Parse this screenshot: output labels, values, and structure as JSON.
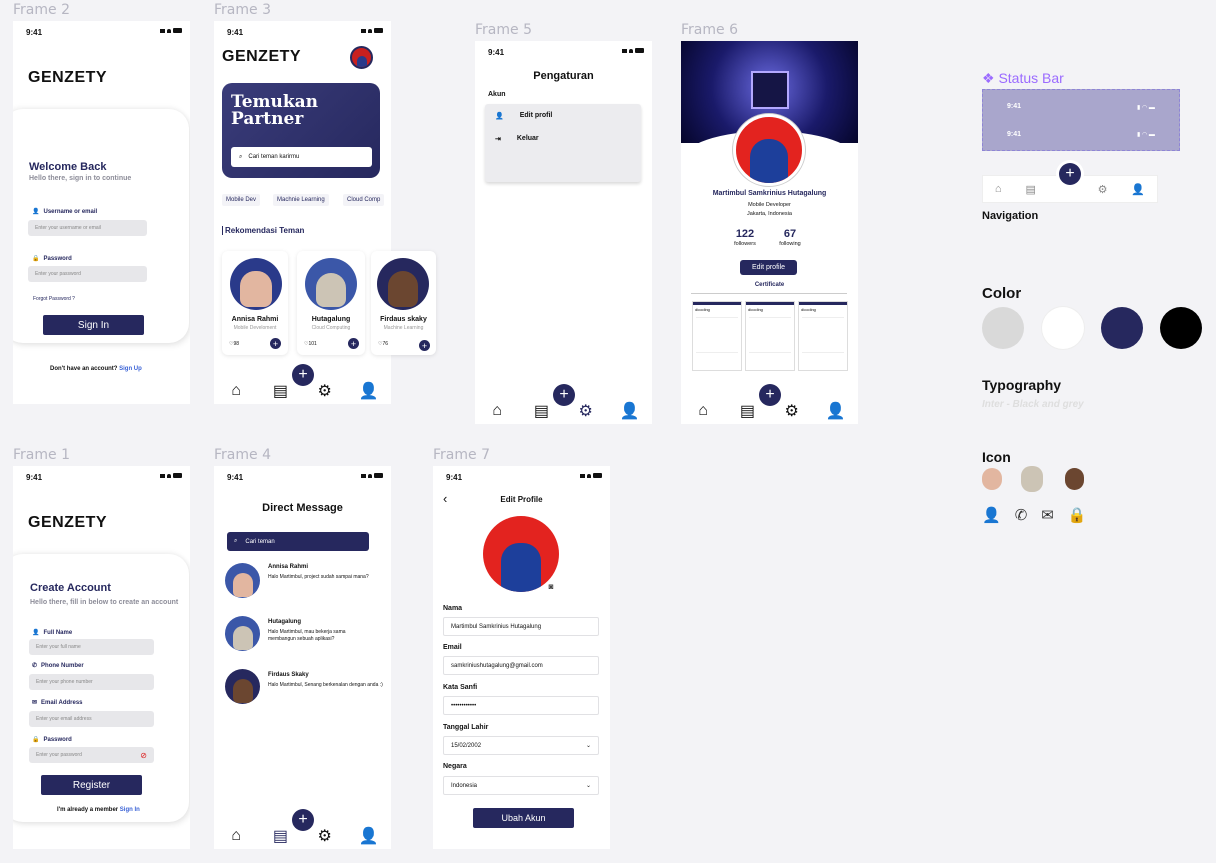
{
  "frames": {
    "f2": "Frame 2",
    "f3": "Frame 3",
    "f5": "Frame 5",
    "f6": "Frame 6",
    "f1": "Frame 1",
    "f4": "Frame 4",
    "f7": "Frame 7"
  },
  "time": "9:41",
  "brand": "GENZETY",
  "login": {
    "title": "Welcome Back",
    "subtitle": "Hello there, sign in to continue",
    "user_label": "Username or email",
    "user_ph": "Enter your username or email",
    "pass_label": "Password",
    "pass_ph": "Enter your password",
    "forgot": "Forgot Password ?",
    "btn": "Sign In",
    "footer": "Don't have an account?",
    "footer_link": "Sign Up"
  },
  "home": {
    "hero_line1": "Temukan",
    "hero_line2": "Partner",
    "search_ph": "Cari teman karirmu",
    "chips": [
      "Mobile Dev",
      "Machnie Learning",
      "Cloud Comp"
    ],
    "section": "Rekomendasi Teman",
    "people": [
      {
        "name": "Annisa Rahmi",
        "role": "Mobile Develoment",
        "likes": "98"
      },
      {
        "name": "Hutagalung",
        "role": "Cloud Computing",
        "likes": "101"
      },
      {
        "name": "Firdaus skaky",
        "role": "Machine Learning",
        "likes": "76"
      }
    ]
  },
  "settings": {
    "title": "Pengaturan",
    "section": "Akun",
    "items": [
      "Edit profil",
      "Keluar"
    ]
  },
  "profile": {
    "name": "Martimbul Samkrinius Hutagalung",
    "role": "Mobile Developer",
    "location": "Jakarta, Indonesia",
    "followers": "122",
    "followers_label": "followers",
    "following": "67",
    "following_label": "following",
    "btn": "Edit profile",
    "tab": "Certificate",
    "cert_brand": "dicoding"
  },
  "register": {
    "title": "Create Account",
    "subtitle": "Hello there, fill in below to create an account",
    "name_label": "Full Name",
    "name_ph": "Enter your full name",
    "phone_label": "Phone Number",
    "phone_ph": "Enter your phone number",
    "email_label": "Email Address",
    "email_ph": "Enter your email address",
    "pass_label": "Password",
    "pass_ph": "Enter your password",
    "btn": "Register",
    "footer": "I'm already a member",
    "footer_link": "Sign In"
  },
  "dm": {
    "title": "Direct Message",
    "search_ph": "Cari teman",
    "messages": [
      {
        "name": "Annisa Rahmi",
        "text": "Halo Martimbul, project sudah sampai mana?"
      },
      {
        "name": "Hutagalung",
        "text": "Halo Martimbul, mau bekerja sama membangun sebuah aplikasi?"
      },
      {
        "name": "Firdaus Skaky",
        "text": "Halo Martimbul, Senang berkenalan dengan anda :)"
      }
    ]
  },
  "edit": {
    "title": "Edit Profile",
    "nama_label": "Nama",
    "nama": "Martimbul Samkrinius Hutagalung",
    "email_label": "Email",
    "email": "samkriniushutagalung@gmail.com",
    "pass_label": "Kata Sanfi",
    "pass": "••••••••••••",
    "dob_label": "Tanggal Lahir",
    "dob": "15/02/2002",
    "country_label": "Negara",
    "country": "Indonesia",
    "btn": "Ubah Akun"
  },
  "guide": {
    "status_bar": "Status Bar",
    "navigation": "Navigation",
    "color": "Color",
    "typography": "Typography",
    "typo_desc": "Inter - Black and grey",
    "icon": "Icon",
    "colors": [
      "#d9d9d9",
      "#ffffff",
      "#26285e",
      "#000000"
    ]
  }
}
